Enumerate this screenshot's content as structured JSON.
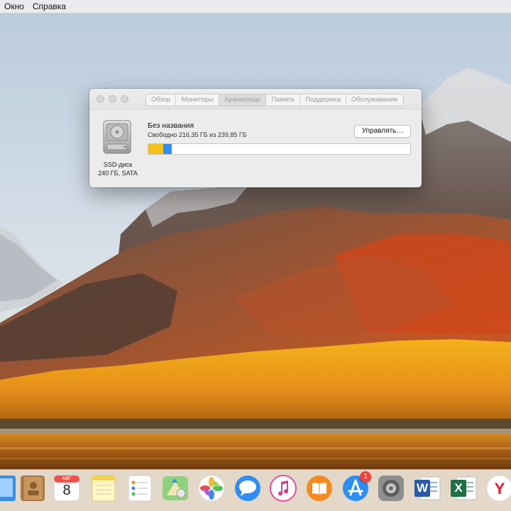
{
  "menubar": {
    "items": [
      {
        "label": "Окно"
      },
      {
        "label": "Справка"
      }
    ]
  },
  "about_window": {
    "tabs": [
      {
        "label": "Обзор",
        "selected": false
      },
      {
        "label": "Мониторы",
        "selected": false
      },
      {
        "label": "Хранилище",
        "selected": true
      },
      {
        "label": "Память",
        "selected": false
      },
      {
        "label": "Поддержка",
        "selected": false
      },
      {
        "label": "Обслуживание",
        "selected": false
      }
    ],
    "disk": {
      "name": "Без названия",
      "free_text": "Свободно 216,35 ГБ из 239,85 ГБ",
      "type_label": "SSD-диск",
      "spec_label": "240 ГБ, SATA",
      "manage_label": "Управлять…",
      "usage_segments": [
        {
          "color": "#f6c21a",
          "fraction": 0.058
        },
        {
          "color": "#2f8df3",
          "fraction": 0.032
        }
      ]
    }
  },
  "dock": {
    "items": [
      {
        "icon": "preview-icon"
      },
      {
        "icon": "contacts-icon"
      },
      {
        "icon": "calendar-icon",
        "month": "АВГ",
        "day": "8"
      },
      {
        "icon": "notes-icon"
      },
      {
        "icon": "reminders-icon"
      },
      {
        "icon": "maps-icon"
      },
      {
        "icon": "photos-icon"
      },
      {
        "icon": "messages-icon"
      },
      {
        "icon": "itunes-icon"
      },
      {
        "icon": "ibooks-icon"
      },
      {
        "icon": "app-store-icon",
        "badge": "1"
      },
      {
        "icon": "system-preferences-icon"
      },
      {
        "icon": "word-icon",
        "letter": "W"
      },
      {
        "icon": "excel-icon",
        "letter": "X"
      },
      {
        "icon": "yandex-browser-icon",
        "letter": "Y"
      }
    ]
  }
}
